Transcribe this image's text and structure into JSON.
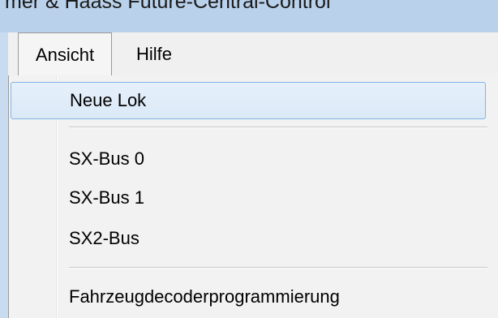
{
  "window": {
    "title": "mer & Haass Future-Central-Control"
  },
  "menubar": {
    "items": [
      {
        "label": "Ansicht"
      },
      {
        "label": "Hilfe"
      }
    ]
  },
  "dropdown": {
    "items": [
      {
        "label": "Neue Lok"
      },
      {
        "label": "SX-Bus 0"
      },
      {
        "label": "SX-Bus 1"
      },
      {
        "label": "SX2-Bus"
      },
      {
        "label": "Fahrzeugdecoderprogrammierung"
      }
    ]
  },
  "colors": {
    "titlebar": "#b9d1ea",
    "menu_background": "#f2f2f2",
    "highlight_border": "#83b2e4"
  }
}
